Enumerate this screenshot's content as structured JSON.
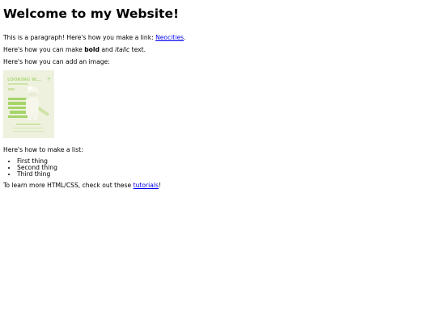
{
  "heading": "Welcome to my Website!",
  "para1": {
    "before": "This is a paragraph! Here's how you make a link: ",
    "link": "Neocities",
    "after": "."
  },
  "para2": {
    "before": "Here's how you can make ",
    "bold": "bold",
    "middle": " and ",
    "italic": "italic",
    "after": " text."
  },
  "para3": "Here's how you can add an image:",
  "image": {
    "text_top": "LOOKING W...",
    "colors": {
      "bg": "#eef1de",
      "accent": "#a6d46a",
      "figure": "#f6f6ea"
    }
  },
  "para4": "Here's how to make a list:",
  "list": [
    "First thing",
    "Second thing",
    "Third thing"
  ],
  "para5": {
    "before": "To learn more HTML/CSS, check out these ",
    "link": "tutorials",
    "after": "!"
  },
  "colors": {
    "link": "#0000ee",
    "text": "#000000",
    "background": "#ffffff"
  }
}
